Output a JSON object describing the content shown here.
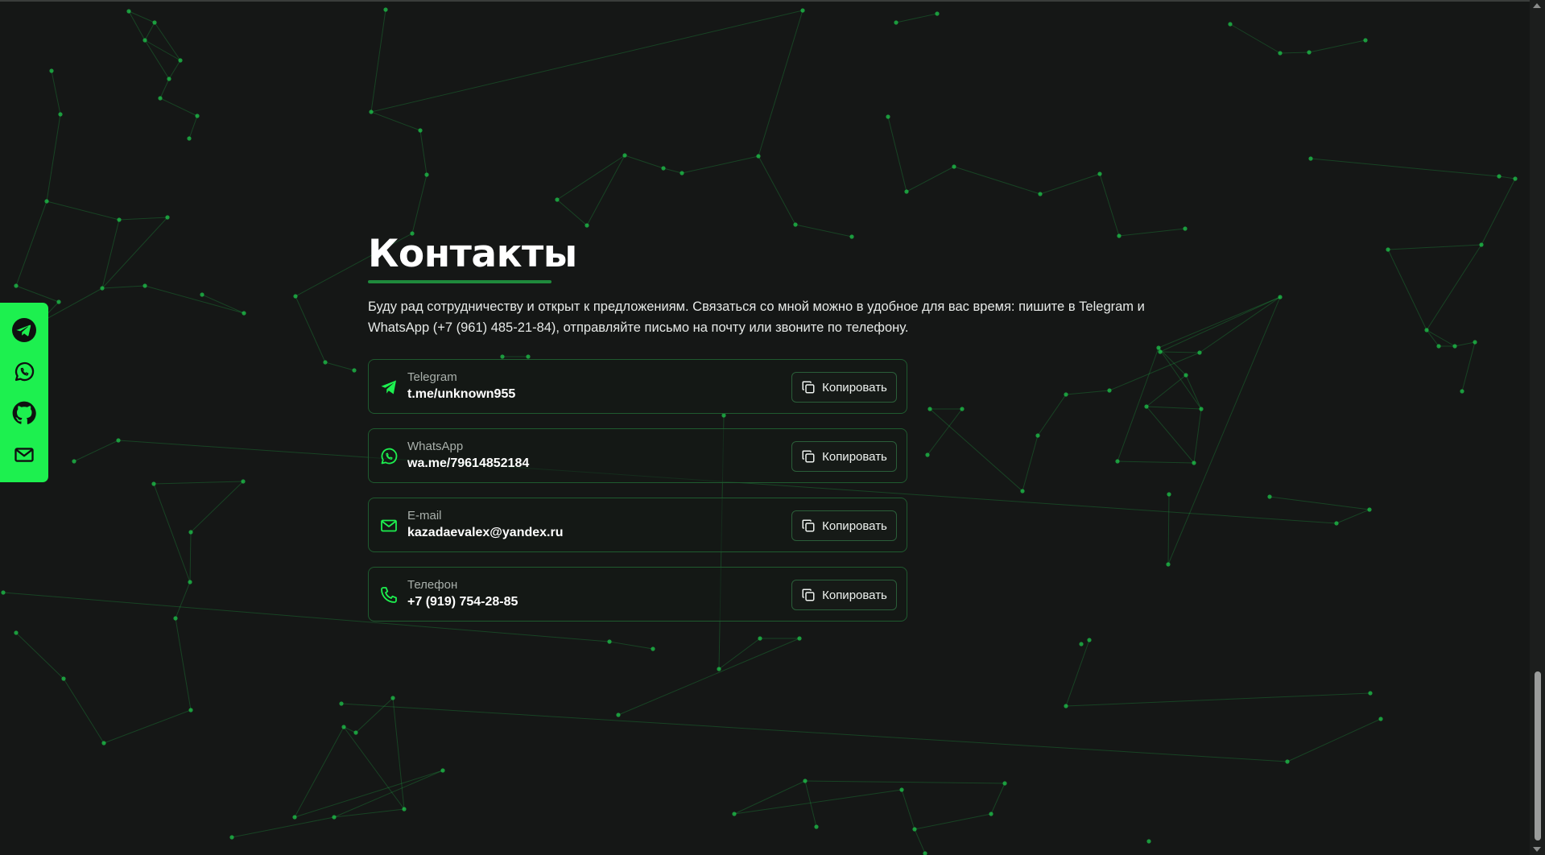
{
  "page": {
    "accent": "#1df04f",
    "background": "#151716"
  },
  "social": [
    {
      "name": "telegram",
      "icon": "telegram-icon"
    },
    {
      "name": "whatsapp",
      "icon": "whatsapp-icon"
    },
    {
      "name": "github",
      "icon": "github-icon"
    },
    {
      "name": "email",
      "icon": "mail-icon"
    }
  ],
  "contacts": {
    "title": "Контакты",
    "intro_line1": "Буду рад сотрудничеству и открыт к предложениям. Связаться со мной можно в удобное для вас время: пишите в Telegram и",
    "intro_line2": "WhatsApp (+7 (961) 485-21-84), отправляйте письмо на почту или звоните по телефону.",
    "items": [
      {
        "label": "Telegram",
        "value": "t.me/unknown955",
        "icon": "send-icon",
        "button": "Копировать"
      },
      {
        "label": "WhatsApp",
        "value": "wa.me/79614852184",
        "icon": "whatsapp-icon",
        "button": "Копировать"
      },
      {
        "label": "E-mail",
        "value": "kazadaevalex@yandex.ru",
        "icon": "mail-icon",
        "button": "Копировать"
      },
      {
        "label": "Телефон",
        "value": "+7 (919) 754-28-85",
        "icon": "phone-icon",
        "button": "Копировать"
      }
    ]
  }
}
